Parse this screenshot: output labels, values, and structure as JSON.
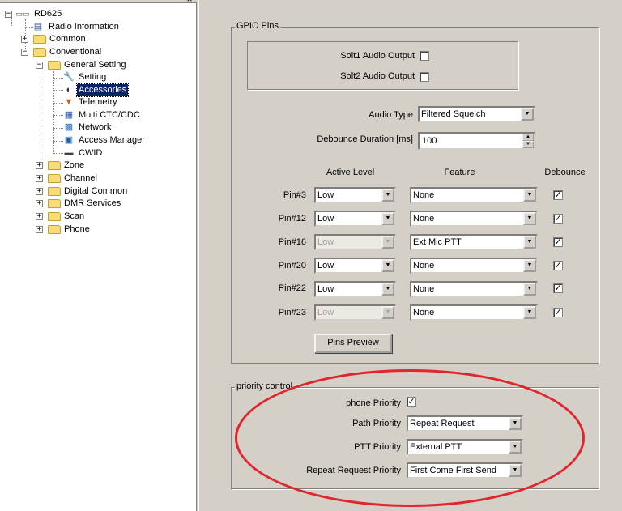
{
  "tree": {
    "root": "RD625",
    "radio_information": "Radio Information",
    "common": "Common",
    "conventional": "Conventional",
    "general_setting": "General Setting",
    "setting": "Setting",
    "accessories": "Accessories",
    "telemetry": "Telemetry",
    "multi_ctc": "Multi CTC/CDC",
    "network": "Network",
    "access_manager": "Access Manager",
    "cwid": "CWID",
    "zone": "Zone",
    "channel": "Channel",
    "digital_common": "Digital Common",
    "dmr_services": "DMR Services",
    "scan": "Scan",
    "phone": "Phone",
    "close_glyph": "×"
  },
  "gpio": {
    "title": "GPIO Pins",
    "slot1_label": "Solt1 Audio Output",
    "slot2_label": "Solt2 Audio Output",
    "audio_type_label": "Audio Type",
    "audio_type_value": "Filtered Squelch",
    "debounce_duration_label": "Debounce Duration [ms]",
    "debounce_duration_value": "100",
    "col_active_level": "Active Level",
    "col_feature": "Feature",
    "col_debounce": "Debounce",
    "pins": [
      {
        "name": "Pin#3",
        "level": "Low",
        "feature": "None",
        "debounce": "✓",
        "disabled": false
      },
      {
        "name": "Pin#12",
        "level": "Low",
        "feature": "None",
        "debounce": "✓",
        "disabled": false
      },
      {
        "name": "Pin#16",
        "level": "Low",
        "feature": "Ext Mic PTT",
        "debounce": "✓",
        "disabled": true
      },
      {
        "name": "Pin#20",
        "level": "Low",
        "feature": "None",
        "debounce": "✓",
        "disabled": false
      },
      {
        "name": "Pin#22",
        "level": "Low",
        "feature": "None",
        "debounce": "✓",
        "disabled": false
      },
      {
        "name": "Pin#23",
        "level": "Low",
        "feature": "None",
        "debounce": "✓",
        "disabled": true
      }
    ],
    "pins_preview_label": "Pins Preview"
  },
  "priority": {
    "title": "priority control",
    "phone_priority_label": "phone Priority",
    "phone_priority_checked": "✓",
    "path_priority_label": "Path Priority",
    "path_priority_value": "Repeat Request",
    "ptt_priority_label": "PTT Priority",
    "ptt_priority_value": "External PTT",
    "repeat_request_priority_label": "Repeat Request Priority",
    "repeat_request_priority_value": "First Come First Send"
  },
  "glyphs": {
    "combo_arrow": "▼",
    "spin_up": "▲",
    "spin_down": "▼"
  },
  "colors": {
    "annotation_ellipse": "#e0262c",
    "selection": "#0a246a",
    "window_bg": "#d4d0c8"
  }
}
